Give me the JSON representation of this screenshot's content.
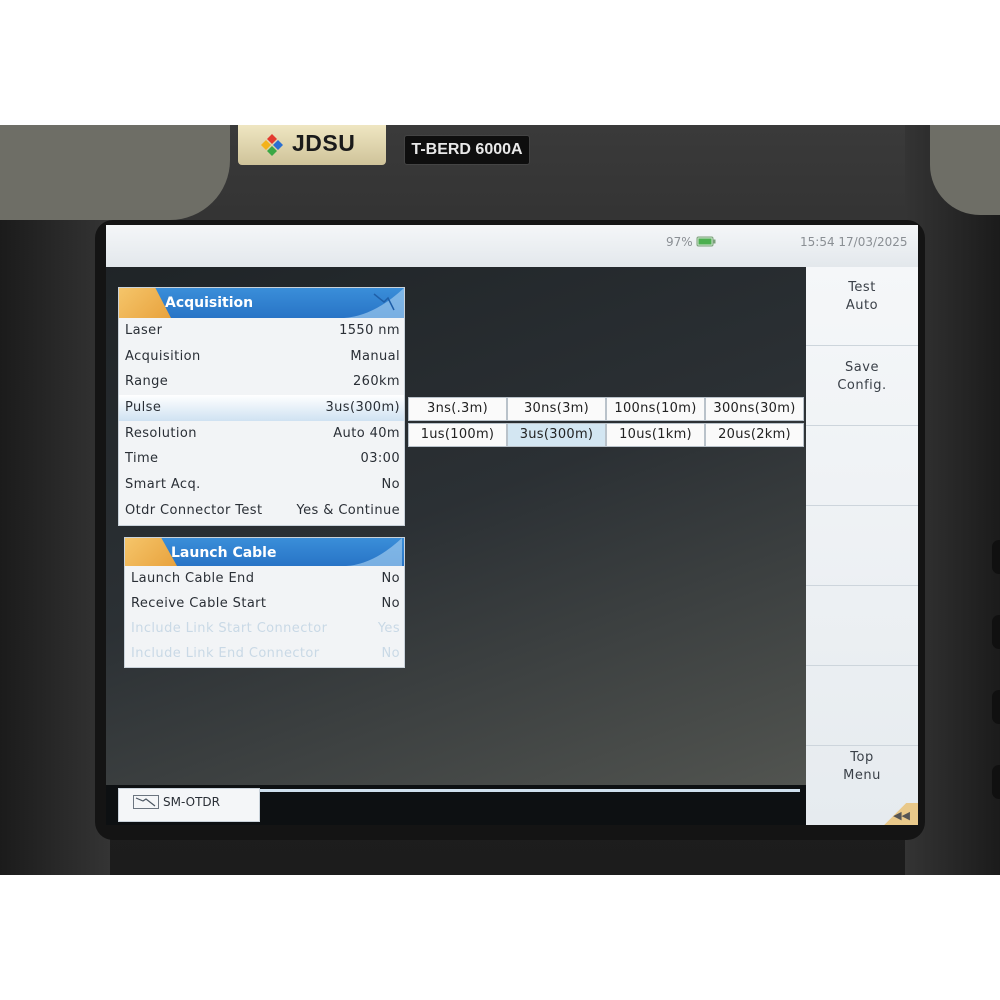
{
  "device": {
    "brand": "JDSU",
    "model": "T-BERD 6000A"
  },
  "status": {
    "battery": "97%",
    "clock": "15:54  17/03/2025"
  },
  "acquisition_panel": {
    "title": "Acquisition",
    "rows": [
      {
        "label": "Laser",
        "value": "1550 nm"
      },
      {
        "label": "Acquisition",
        "value": "Manual"
      },
      {
        "label": "Range",
        "value": "260km"
      },
      {
        "label": "Pulse",
        "value": "3us(300m)"
      },
      {
        "label": "Resolution",
        "value": "Auto 40m"
      },
      {
        "label": "Time",
        "value": "03:00"
      },
      {
        "label": "Smart Acq.",
        "value": "No"
      },
      {
        "label": "Otdr Connector Test",
        "value": "Yes & Continue"
      }
    ]
  },
  "launch_panel": {
    "title": "Launch Cable",
    "rows": [
      {
        "label": "Launch Cable End",
        "value": "No"
      },
      {
        "label": "Receive Cable Start",
        "value": "No"
      },
      {
        "label": "Include Link Start Connector",
        "value": "Yes"
      },
      {
        "label": "Include Link End Connector",
        "value": "No"
      }
    ]
  },
  "pulse_options": [
    "3ns(.3m)",
    "30ns(3m)",
    "100ns(10m)",
    "300ns(30m)",
    "1us(100m)",
    "3us(300m)",
    "10us(1km)",
    "20us(2km)"
  ],
  "softkeys": {
    "test_auto": {
      "line1": "Test",
      "line2": "Auto"
    },
    "save_config": {
      "line1": "Save",
      "line2": "Config."
    },
    "top_menu": {
      "line1": "Top",
      "line2": "Menu"
    },
    "back": "◀◀"
  },
  "bottom_tab": {
    "label": "SM-OTDR"
  },
  "colors": {
    "panel_header": "#2f80d0",
    "panel_tab": "#f0b552",
    "selected": "#d3e6f2"
  }
}
